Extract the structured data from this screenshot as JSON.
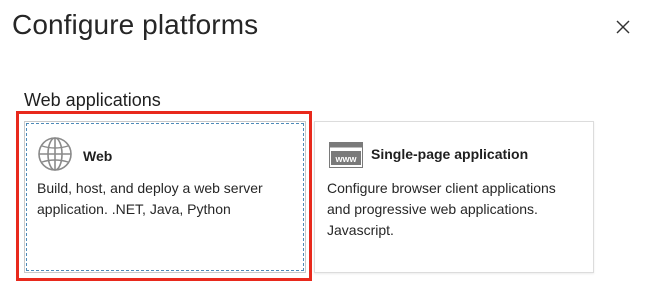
{
  "dialog": {
    "title": "Configure platforms",
    "close_label": "Close",
    "close_icon": "close-icon"
  },
  "section": {
    "heading": "Web applications"
  },
  "platforms": [
    {
      "id": "web",
      "title": "Web",
      "description": "Build, host, and deploy a web server application. .NET, Java, Python",
      "icon": "globe-icon",
      "selected": true
    },
    {
      "id": "spa",
      "title": "Single-page application",
      "description": "Configure browser client applications and progressive web applications. Javascript.",
      "icon": "www-browser-icon",
      "icon_text": "www",
      "selected": false
    }
  ],
  "colors": {
    "highlight": "#e8291c",
    "focus_outline": "#4e8ab8",
    "card_border": "#dcdcdc",
    "text": "#1f1f1f"
  }
}
